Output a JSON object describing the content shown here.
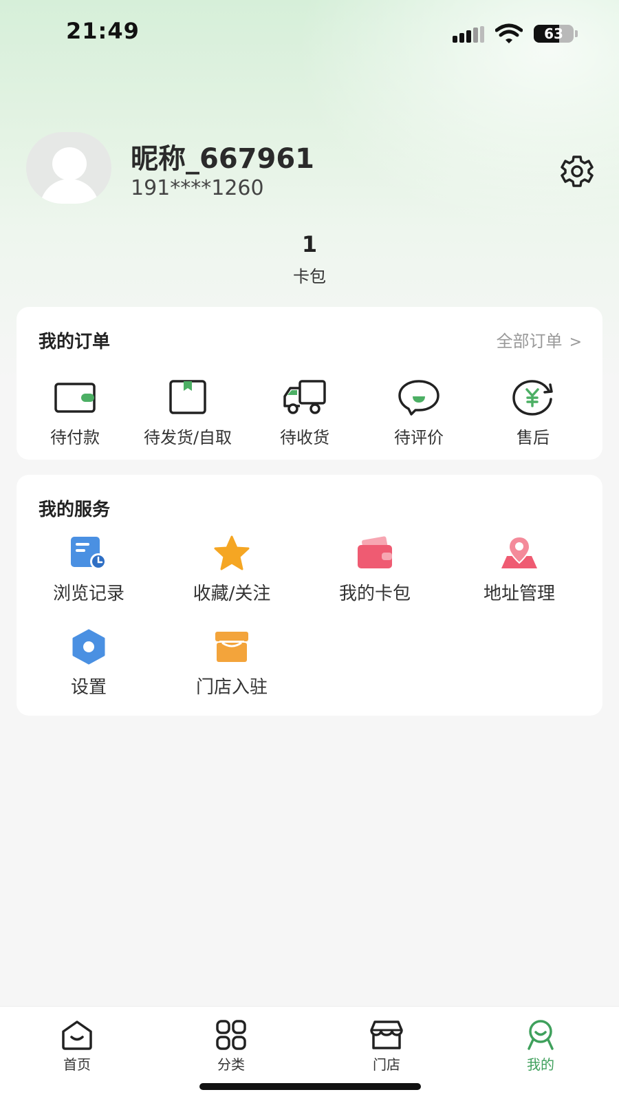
{
  "status_bar": {
    "time": "21:49",
    "battery": "63",
    "battery_level": 0.63
  },
  "profile": {
    "nickname": "昵称_667961",
    "phone": "191****1260",
    "stats": [
      {
        "value": "1",
        "label": "卡包"
      }
    ]
  },
  "orders": {
    "title": "我的订单",
    "all_label": "全部订单",
    "items": [
      {
        "label": "待付款",
        "icon": "wallet-icon"
      },
      {
        "label": "待发货/自取",
        "icon": "package-icon"
      },
      {
        "label": "待收货",
        "icon": "truck-icon"
      },
      {
        "label": "待评价",
        "icon": "comment-icon"
      },
      {
        "label": "售后",
        "icon": "refund-icon"
      }
    ]
  },
  "services": {
    "title": "我的服务",
    "items": [
      {
        "label": "浏览记录",
        "icon": "history-icon"
      },
      {
        "label": "收藏/关注",
        "icon": "star-icon"
      },
      {
        "label": "我的卡包",
        "icon": "card-wallet-icon"
      },
      {
        "label": "地址管理",
        "icon": "location-icon"
      },
      {
        "label": "设置",
        "icon": "settings-hex-icon"
      },
      {
        "label": "门店入驻",
        "icon": "store-icon"
      }
    ]
  },
  "nav": {
    "items": [
      {
        "label": "首页",
        "icon": "home-icon"
      },
      {
        "label": "分类",
        "icon": "category-icon"
      },
      {
        "label": "门店",
        "icon": "shop-icon"
      },
      {
        "label": "我的",
        "icon": "profile-icon",
        "active": true
      }
    ]
  },
  "colors": {
    "accent": "#3fa05c",
    "star": "#f5a623",
    "history": "#4a90e2",
    "card": "#ef5b72",
    "store": "#f3a43b"
  }
}
